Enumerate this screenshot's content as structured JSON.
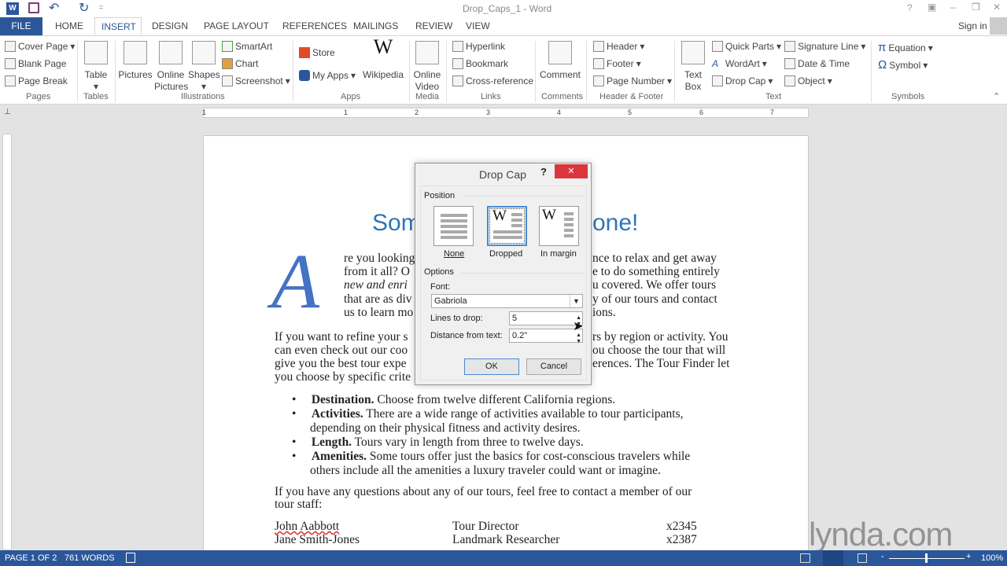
{
  "title_bar": {
    "doc_title": "Drop_Caps_1 - Word",
    "help": "?",
    "ribbon_display": "▣",
    "minimize": "–",
    "restore": "❐",
    "close": "✕",
    "qat_more": "="
  },
  "tabs": [
    "FILE",
    "HOME",
    "INSERT",
    "DESIGN",
    "PAGE LAYOUT",
    "REFERENCES",
    "MAILINGS",
    "REVIEW",
    "VIEW"
  ],
  "sign_in": "Sign in",
  "ribbon": {
    "pages": {
      "items": [
        "Cover Page",
        "Blank Page",
        "Page Break"
      ],
      "label": "Pages"
    },
    "tables": {
      "items": [
        "Table"
      ],
      "label": "Tables"
    },
    "illustrations": {
      "big": [
        "Pictures",
        "Online Pictures",
        "Shapes"
      ],
      "small": [
        "SmartArt",
        "Chart",
        "Screenshot"
      ],
      "label": "Illustrations"
    },
    "apps": {
      "items": [
        "Store",
        "My Apps",
        "Wikipedia"
      ],
      "label": "Apps"
    },
    "media": {
      "items": [
        "Online Video"
      ],
      "label": "Media"
    },
    "links": {
      "items": [
        "Hyperlink",
        "Bookmark",
        "Cross-reference"
      ],
      "label": "Links"
    },
    "comments": {
      "items": [
        "Comment"
      ],
      "label": "Comments"
    },
    "header_footer": {
      "items": [
        "Header",
        "Footer",
        "Page Number"
      ],
      "label": "Header & Footer"
    },
    "text": {
      "items": [
        "Text Box",
        "Quick Parts",
        "WordArt",
        "Drop Cap",
        "Signature Line",
        "Date & Time",
        "Object"
      ],
      "label": "Text"
    },
    "symbols": {
      "items": [
        "Equation",
        "Symbol"
      ],
      "label": "Symbols"
    }
  },
  "ruler_numbers": [
    "1",
    "1",
    "2",
    "3",
    "4",
    "5",
    "6",
    "7"
  ],
  "document": {
    "heading_left": "Som",
    "heading_right": "one!",
    "drop_cap": "A",
    "p1_left": [
      "re you looking",
      "from it all? O",
      "new and enri",
      "that are as div",
      "us to learn mo"
    ],
    "p1_right": [
      "nce to relax and get away",
      "e to do something entirely",
      "u covered. We offer tours",
      "y of our tours and contact",
      "ions."
    ],
    "p2_left": [
      "If you want to refine your s",
      "can even check out our coo",
      "give you the best tour expe",
      "you choose by specific crite"
    ],
    "p2_right": [
      "rs by region or activity. You",
      "ou choose the tour that will",
      "erences. The Tour Finder let"
    ],
    "bullets": [
      {
        "bold": "Destination.",
        "text": " Choose from twelve different California regions."
      },
      {
        "bold": "Activities.",
        "text": " There are a wide range of activities available to tour participants,",
        "cont": "depending on their physical fitness and activity desires."
      },
      {
        "bold": "Length.",
        "text": " Tours vary in length from three to twelve days."
      },
      {
        "bold": "Amenities.",
        "text": " Some tours offer just the basics for cost-conscious travelers while",
        "cont": "others include all the amenities a luxury traveler could want or imagine."
      }
    ],
    "p3": [
      "If you have any questions about any of our tours, feel free to contact a member of our",
      "tour staff:"
    ],
    "staff": [
      {
        "name": "John Aabbott",
        "role": "Tour Director",
        "ext": "x2345"
      },
      {
        "name": "Jane Smith-Jones",
        "role": "Landmark Researcher",
        "ext": "x2387"
      }
    ]
  },
  "dialog": {
    "title": "Drop Cap",
    "help": "?",
    "close": "✕",
    "position_label": "Position",
    "positions": [
      "None",
      "Dropped",
      "In margin"
    ],
    "selected_position": "Dropped",
    "options_label": "Options",
    "font_label": "Font:",
    "font_value": "Gabriola",
    "lines_label": "Lines to drop:",
    "lines_value": "5",
    "distance_label": "Distance from text:",
    "distance_value": "0.2\"",
    "ok": "OK",
    "cancel": "Cancel"
  },
  "status": {
    "page": "PAGE 1 OF 2",
    "words": "761 WORDS",
    "zoom": "100%",
    "zoom_minus": "-",
    "zoom_plus": "+",
    "zoom_level_percent": 100
  },
  "watermark": "lynda.com",
  "colors": {
    "accent": "#2b579a",
    "heading": "#2e75b6",
    "close_red": "#d9363e",
    "drop_cap": "#4472c4"
  }
}
